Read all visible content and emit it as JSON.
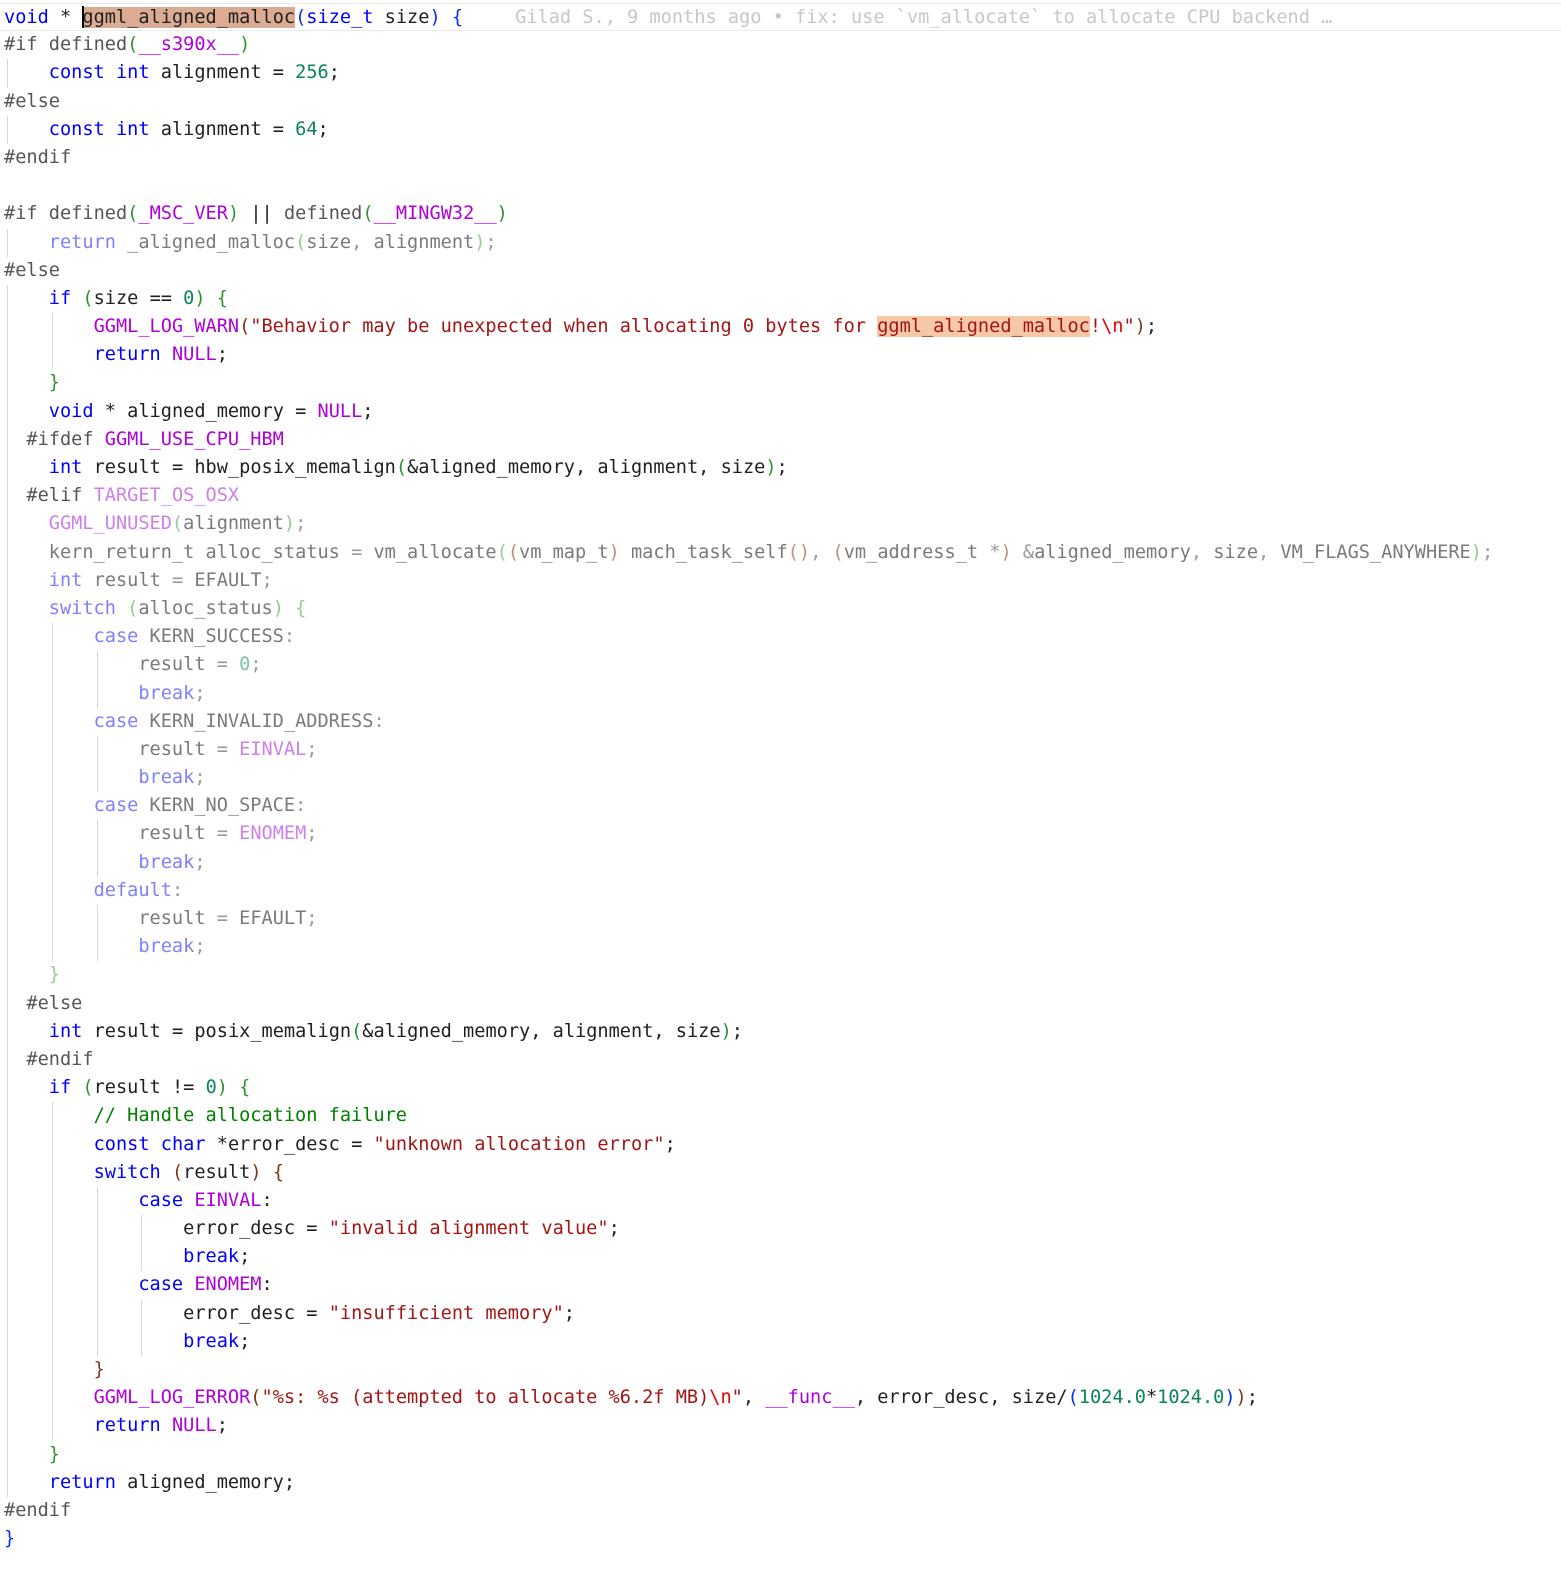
{
  "editor": {
    "language": "c",
    "cursor": {
      "line": 1,
      "col": 8
    },
    "selected_token": "ggml_aligned_malloc",
    "blame": {
      "author": "Gilad S.",
      "age": "9 months ago",
      "message": "fix: use `vm_allocate` to allocate CPU backend …",
      "text": "Gilad S., 9 months ago • fix: use `vm_allocate` to allocate CPU backend …"
    },
    "colors": {
      "keyword": "#0000ff",
      "macro": "#af00db",
      "string": "#a31515",
      "number": "#098658",
      "comment": "#008000",
      "preprocessor": "#555555",
      "selection_highlight": "#dcab94",
      "occurrence_highlight": "#f6c8a8"
    },
    "lines": [
      "void * ggml_aligned_malloc(size_t size) {",
      "#if defined(__s390x__)",
      "    const int alignment = 256;",
      "#else",
      "    const int alignment = 64;",
      "#endif",
      "",
      "#if defined(_MSC_VER) || defined(__MINGW32__)",
      "    return _aligned_malloc(size, alignment);",
      "#else",
      "    if (size == 0) {",
      "        GGML_LOG_WARN(\"Behavior may be unexpected when allocating 0 bytes for ggml_aligned_malloc!\\n\");",
      "        return NULL;",
      "    }",
      "    void * aligned_memory = NULL;",
      "  #ifdef GGML_USE_CPU_HBM",
      "    int result = hbw_posix_memalign(&aligned_memory, alignment, size);",
      "  #elif TARGET_OS_OSX",
      "    GGML_UNUSED(alignment);",
      "    kern_return_t alloc_status = vm_allocate((vm_map_t) mach_task_self(), (vm_address_t *) &aligned_memory, size, VM_FLAGS_ANYWHERE);",
      "    int result = EFAULT;",
      "    switch (alloc_status) {",
      "        case KERN_SUCCESS:",
      "            result = 0;",
      "            break;",
      "        case KERN_INVALID_ADDRESS:",
      "            result = EINVAL;",
      "            break;",
      "        case KERN_NO_SPACE:",
      "            result = ENOMEM;",
      "            break;",
      "        default:",
      "            result = EFAULT;",
      "            break;",
      "    }",
      "  #else",
      "    int result = posix_memalign(&aligned_memory, alignment, size);",
      "  #endif",
      "    if (result != 0) {",
      "        // Handle allocation failure",
      "        const char *error_desc = \"unknown allocation error\";",
      "        switch (result) {",
      "            case EINVAL:",
      "                error_desc = \"invalid alignment value\";",
      "                break;",
      "            case ENOMEM:",
      "                error_desc = \"insufficient memory\";",
      "                break;",
      "        }",
      "        GGML_LOG_ERROR(\"%s: %s (attempted to allocate %6.2f MB)\\n\", __func__, error_desc, size/(1024.0*1024.0));",
      "        return NULL;",
      "    }",
      "    return aligned_memory;",
      "#endif",
      "}"
    ]
  }
}
